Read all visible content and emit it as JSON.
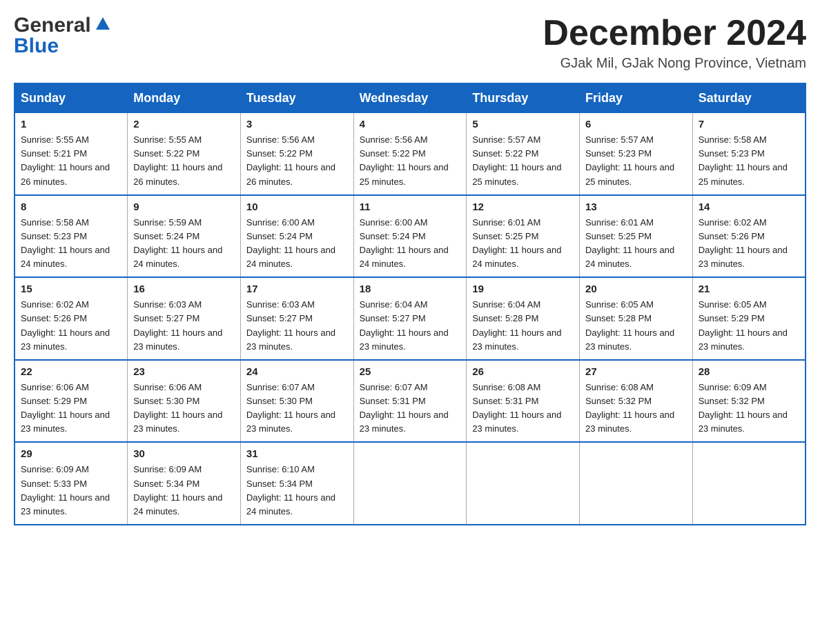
{
  "header": {
    "logo_top": "General",
    "logo_triangle": "▶",
    "logo_bottom": "Blue",
    "month_title": "December 2024",
    "location": "GJak Mil, GJak Nong Province, Vietnam"
  },
  "days_of_week": [
    "Sunday",
    "Monday",
    "Tuesday",
    "Wednesday",
    "Thursday",
    "Friday",
    "Saturday"
  ],
  "weeks": [
    [
      {
        "day": "1",
        "sunrise": "5:55 AM",
        "sunset": "5:21 PM",
        "daylight": "11 hours and 26 minutes."
      },
      {
        "day": "2",
        "sunrise": "5:55 AM",
        "sunset": "5:22 PM",
        "daylight": "11 hours and 26 minutes."
      },
      {
        "day": "3",
        "sunrise": "5:56 AM",
        "sunset": "5:22 PM",
        "daylight": "11 hours and 26 minutes."
      },
      {
        "day": "4",
        "sunrise": "5:56 AM",
        "sunset": "5:22 PM",
        "daylight": "11 hours and 25 minutes."
      },
      {
        "day": "5",
        "sunrise": "5:57 AM",
        "sunset": "5:22 PM",
        "daylight": "11 hours and 25 minutes."
      },
      {
        "day": "6",
        "sunrise": "5:57 AM",
        "sunset": "5:23 PM",
        "daylight": "11 hours and 25 minutes."
      },
      {
        "day": "7",
        "sunrise": "5:58 AM",
        "sunset": "5:23 PM",
        "daylight": "11 hours and 25 minutes."
      }
    ],
    [
      {
        "day": "8",
        "sunrise": "5:58 AM",
        "sunset": "5:23 PM",
        "daylight": "11 hours and 24 minutes."
      },
      {
        "day": "9",
        "sunrise": "5:59 AM",
        "sunset": "5:24 PM",
        "daylight": "11 hours and 24 minutes."
      },
      {
        "day": "10",
        "sunrise": "6:00 AM",
        "sunset": "5:24 PM",
        "daylight": "11 hours and 24 minutes."
      },
      {
        "day": "11",
        "sunrise": "6:00 AM",
        "sunset": "5:24 PM",
        "daylight": "11 hours and 24 minutes."
      },
      {
        "day": "12",
        "sunrise": "6:01 AM",
        "sunset": "5:25 PM",
        "daylight": "11 hours and 24 minutes."
      },
      {
        "day": "13",
        "sunrise": "6:01 AM",
        "sunset": "5:25 PM",
        "daylight": "11 hours and 24 minutes."
      },
      {
        "day": "14",
        "sunrise": "6:02 AM",
        "sunset": "5:26 PM",
        "daylight": "11 hours and 23 minutes."
      }
    ],
    [
      {
        "day": "15",
        "sunrise": "6:02 AM",
        "sunset": "5:26 PM",
        "daylight": "11 hours and 23 minutes."
      },
      {
        "day": "16",
        "sunrise": "6:03 AM",
        "sunset": "5:27 PM",
        "daylight": "11 hours and 23 minutes."
      },
      {
        "day": "17",
        "sunrise": "6:03 AM",
        "sunset": "5:27 PM",
        "daylight": "11 hours and 23 minutes."
      },
      {
        "day": "18",
        "sunrise": "6:04 AM",
        "sunset": "5:27 PM",
        "daylight": "11 hours and 23 minutes."
      },
      {
        "day": "19",
        "sunrise": "6:04 AM",
        "sunset": "5:28 PM",
        "daylight": "11 hours and 23 minutes."
      },
      {
        "day": "20",
        "sunrise": "6:05 AM",
        "sunset": "5:28 PM",
        "daylight": "11 hours and 23 minutes."
      },
      {
        "day": "21",
        "sunrise": "6:05 AM",
        "sunset": "5:29 PM",
        "daylight": "11 hours and 23 minutes."
      }
    ],
    [
      {
        "day": "22",
        "sunrise": "6:06 AM",
        "sunset": "5:29 PM",
        "daylight": "11 hours and 23 minutes."
      },
      {
        "day": "23",
        "sunrise": "6:06 AM",
        "sunset": "5:30 PM",
        "daylight": "11 hours and 23 minutes."
      },
      {
        "day": "24",
        "sunrise": "6:07 AM",
        "sunset": "5:30 PM",
        "daylight": "11 hours and 23 minutes."
      },
      {
        "day": "25",
        "sunrise": "6:07 AM",
        "sunset": "5:31 PM",
        "daylight": "11 hours and 23 minutes."
      },
      {
        "day": "26",
        "sunrise": "6:08 AM",
        "sunset": "5:31 PM",
        "daylight": "11 hours and 23 minutes."
      },
      {
        "day": "27",
        "sunrise": "6:08 AM",
        "sunset": "5:32 PM",
        "daylight": "11 hours and 23 minutes."
      },
      {
        "day": "28",
        "sunrise": "6:09 AM",
        "sunset": "5:32 PM",
        "daylight": "11 hours and 23 minutes."
      }
    ],
    [
      {
        "day": "29",
        "sunrise": "6:09 AM",
        "sunset": "5:33 PM",
        "daylight": "11 hours and 23 minutes."
      },
      {
        "day": "30",
        "sunrise": "6:09 AM",
        "sunset": "5:34 PM",
        "daylight": "11 hours and 24 minutes."
      },
      {
        "day": "31",
        "sunrise": "6:10 AM",
        "sunset": "5:34 PM",
        "daylight": "11 hours and 24 minutes."
      },
      null,
      null,
      null,
      null
    ]
  ]
}
